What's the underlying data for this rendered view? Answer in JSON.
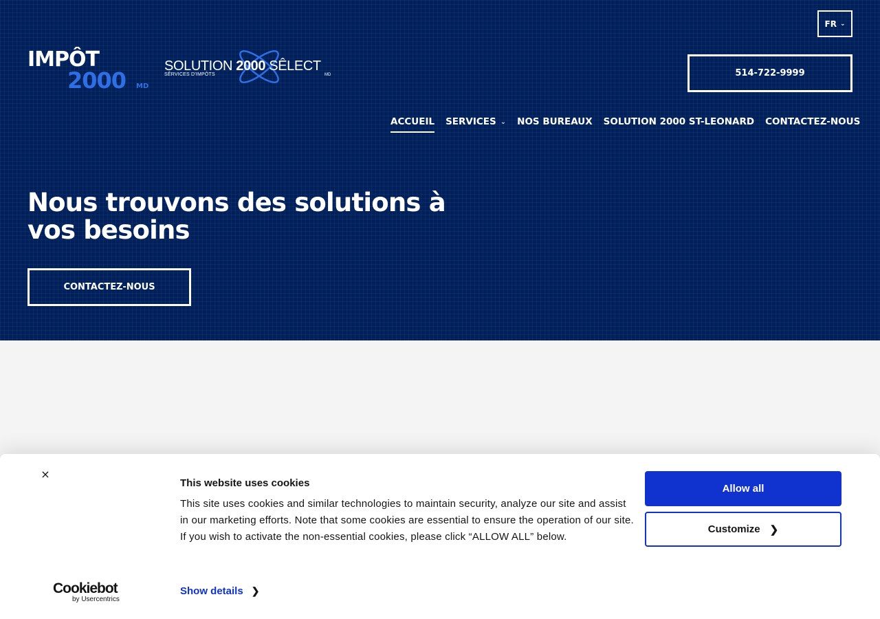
{
  "header": {
    "language": {
      "label": "FR",
      "icon": "chevron-down-icon"
    },
    "logo_impot": {
      "line1": "IMPÔT",
      "line2": "2000",
      "suffix": "MD"
    },
    "logo_solution": {
      "text_a": "SOLUTION",
      "text_b": "2000",
      "text_c": "SÊLECT",
      "subtitle": "SÊRVICES D'IMPÔTS",
      "suffix": "MD"
    },
    "phone": "514-722-9999"
  },
  "nav": {
    "items": [
      {
        "label": "ACCUEIL",
        "active": true
      },
      {
        "label": "SERVICES",
        "has_dropdown": true
      },
      {
        "label": "NOS BUREAUX"
      },
      {
        "label": "SOLUTION 2000 ST-LEONARD"
      },
      {
        "label": "CONTACTEZ-NOUS"
      }
    ]
  },
  "hero": {
    "title": "Nous trouvons des solutions à vos besoins",
    "cta_label": "CONTACTEZ-NOUS"
  },
  "cookie_banner": {
    "title": "This website uses cookies",
    "text": "This site uses cookies and similar technologies to maintain security, analyze our site and assist in our marketing efforts. Note that some cookies are essential to ensure the operation of our site. If you wish to activate the non-essential cookies, please click “ALLOW ALL” below.",
    "show_details": "Show details",
    "allow_all": "Allow all",
    "customize": "Customize",
    "brand": "Cookiebot",
    "brand_sub": "by Usercentrics",
    "close": "×"
  },
  "colors": {
    "hero_bg": "#00205b",
    "accent_blue": "#2f6fe6",
    "cookie_blue": "#1032cf"
  }
}
